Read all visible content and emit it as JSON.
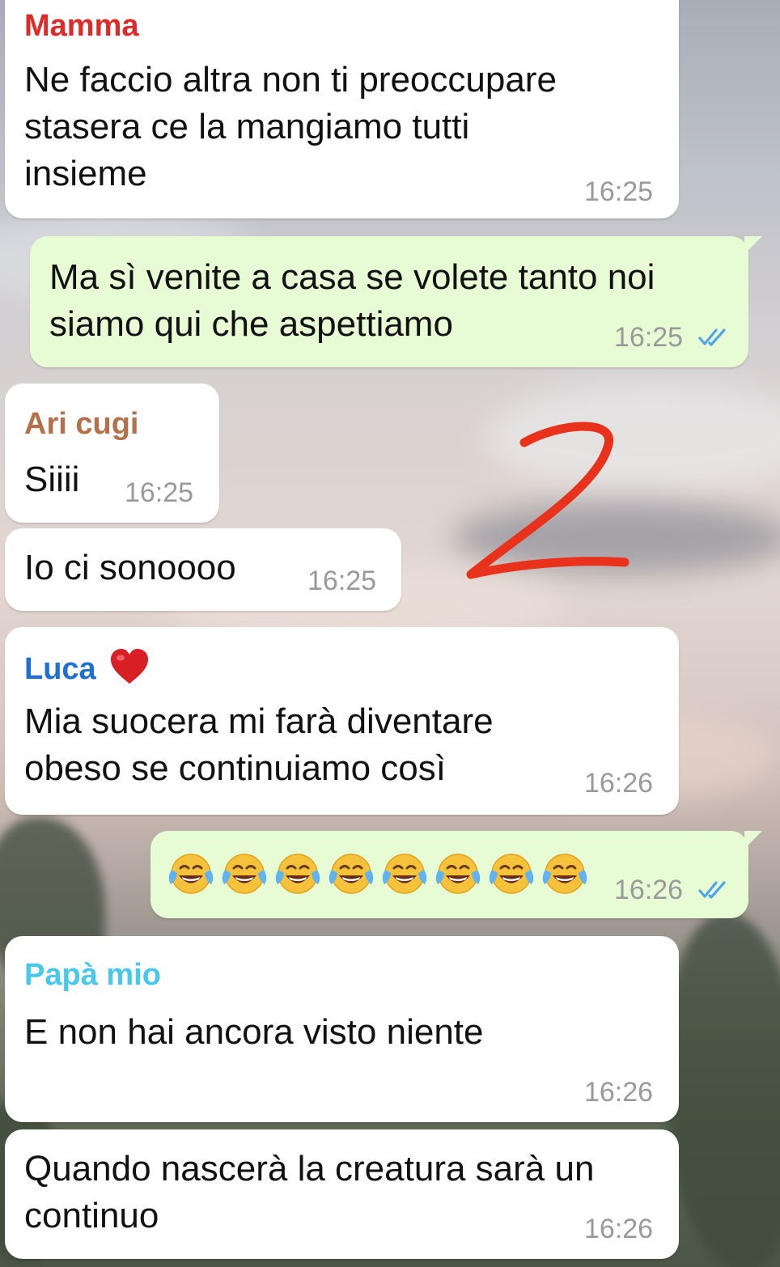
{
  "messages": [
    {
      "sender": "Mamma",
      "text": "Ne faccio altra non ti preoccupare\nstasera ce la mangiamo tutti\ninsieme",
      "time": "16:25"
    },
    {
      "text": "Ma sì venite a casa se volete tanto noi\nsiamo qui che aspettiamo",
      "time": "16:25",
      "status": "read"
    },
    {
      "sender": "Ari cugi",
      "text": "Siiii",
      "time": "16:25"
    },
    {
      "text": "Io ci sonoooo",
      "time": "16:25"
    },
    {
      "sender": "Luca",
      "sender_suffix": "❤️",
      "text": "Mia suocera mi farà diventare\nobeso se continuiamo così",
      "time": "16:26"
    },
    {
      "text": "😂😂😂😂😂😂😂😂",
      "time": "16:26",
      "status": "read"
    },
    {
      "sender": "Papà mio",
      "text": "E non hai ancora visto niente",
      "time": "16:26"
    },
    {
      "text": "Quando nascerà la creatura sarà un\ncontinuo",
      "time": "16:26"
    }
  ],
  "annotation": {
    "text": "2",
    "color": "#e8321c"
  },
  "colors": {
    "sender_mamma": "#e02a2a",
    "sender_ari": "#b3704a",
    "sender_luca": "#1f6fd6",
    "sender_papa": "#48c8ea",
    "outgoing_bubble": "#e7fcd4",
    "incoming_bubble": "#ffffff",
    "read_ticks": "#4fa6e6"
  },
  "icons": {
    "read_receipt": "double-check-icon",
    "heart": "red-heart-icon",
    "emoji": "face-with-tears-of-joy"
  }
}
